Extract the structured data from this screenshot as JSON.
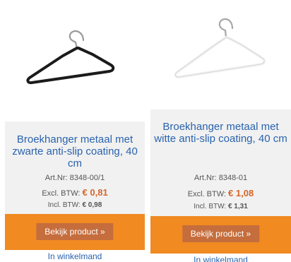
{
  "products": [
    {
      "title": "Broekhanger metaal met zwarte anti-slip coating, 40 cm",
      "art_label": "Art.Nr:",
      "art_nr": "8348-00/1",
      "excl_label": "Excl. BTW:",
      "excl_price": "€ 0,81",
      "incl_label": "Incl. BTW:",
      "incl_price": "€ 0,98",
      "button_label": "Bekijk product »",
      "cart_label": "In winkelmand",
      "hanger_color": "#1b1b1b"
    },
    {
      "title": "Broekhanger metaal met witte anti-slip coating, 40 cm",
      "art_label": "Art.Nr:",
      "art_nr": "8348-01",
      "excl_label": "Excl. BTW:",
      "excl_price": "€ 1,08",
      "incl_label": "Incl. BTW:",
      "incl_price": "€ 1,31",
      "button_label": "Bekijk product »",
      "cart_label": "In winkelmand",
      "hanger_color": "#f2f2f2"
    }
  ],
  "colors": {
    "title": "#2a63ad",
    "price": "#d4662c",
    "cta_bar": "#f08a21",
    "button": "#c56d3c",
    "panel": "#f1f1f1"
  }
}
